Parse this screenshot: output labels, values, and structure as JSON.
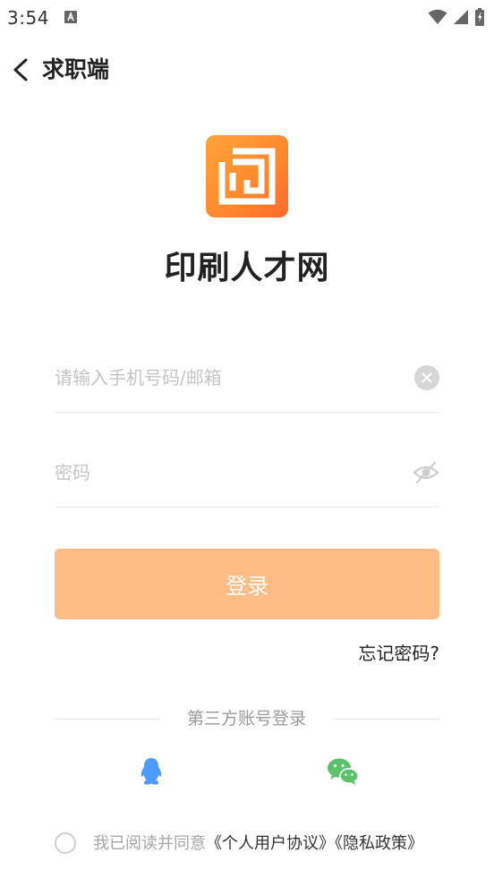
{
  "status_bar": {
    "time": "3:54"
  },
  "header": {
    "title": "求职端"
  },
  "app": {
    "name": "印刷人才网"
  },
  "login_form": {
    "account": {
      "value": "",
      "placeholder": "请输入手机号码/邮箱"
    },
    "password": {
      "value": "",
      "placeholder": "密码"
    },
    "login_label": "登录",
    "forgot_password": "忘记密码?"
  },
  "third_party": {
    "title": "第三方账号登录",
    "providers": [
      {
        "name": "QQ",
        "icon": "qq-icon",
        "color": "#4c9cff"
      },
      {
        "name": "WeChat",
        "icon": "wechat-icon",
        "color": "#5ac26a"
      }
    ]
  },
  "agreement": {
    "checked": false,
    "prefix": "我已阅读并同意",
    "user_agreement": "《个人用户协议》",
    "privacy_policy": "《隐私政策》"
  },
  "colors": {
    "accent": "#ff8a2e",
    "login_button": "#ffbc85"
  }
}
